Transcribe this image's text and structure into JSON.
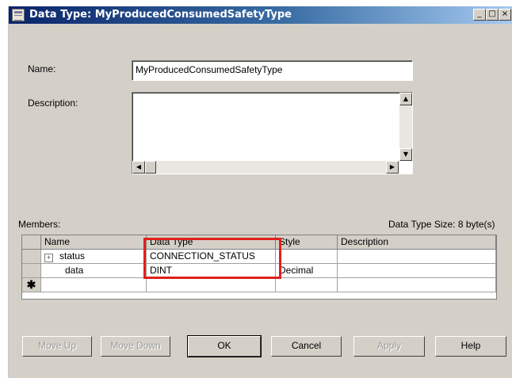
{
  "window": {
    "title": "Data Type: MyProducedConsumedSafetyType",
    "controls": [
      "_",
      "□",
      "×"
    ]
  },
  "form": {
    "name_label": "Name:",
    "name_value": "MyProducedConsumedSafetyType",
    "description_label": "Description:",
    "description_value": ""
  },
  "members": {
    "label": "Members:",
    "size_text": "Data Type Size: 8 byte(s)",
    "columns": [
      "Name",
      "Data Type",
      "Style",
      "Description"
    ],
    "rows": [
      {
        "marker": "",
        "expand": "+",
        "name": "status",
        "data_type": "CONNECTION_STATUS",
        "style": "",
        "description": ""
      },
      {
        "marker": "",
        "expand": "",
        "name": "data",
        "data_type": "DINT",
        "style": "Decimal",
        "description": ""
      },
      {
        "marker": "✱",
        "expand": "",
        "name": "",
        "data_type": "",
        "style": "",
        "description": ""
      }
    ]
  },
  "buttons": {
    "move_up": "Move Up",
    "move_down": "Move Down",
    "ok": "OK",
    "cancel": "Cancel",
    "apply": "Apply",
    "help": "Help"
  }
}
